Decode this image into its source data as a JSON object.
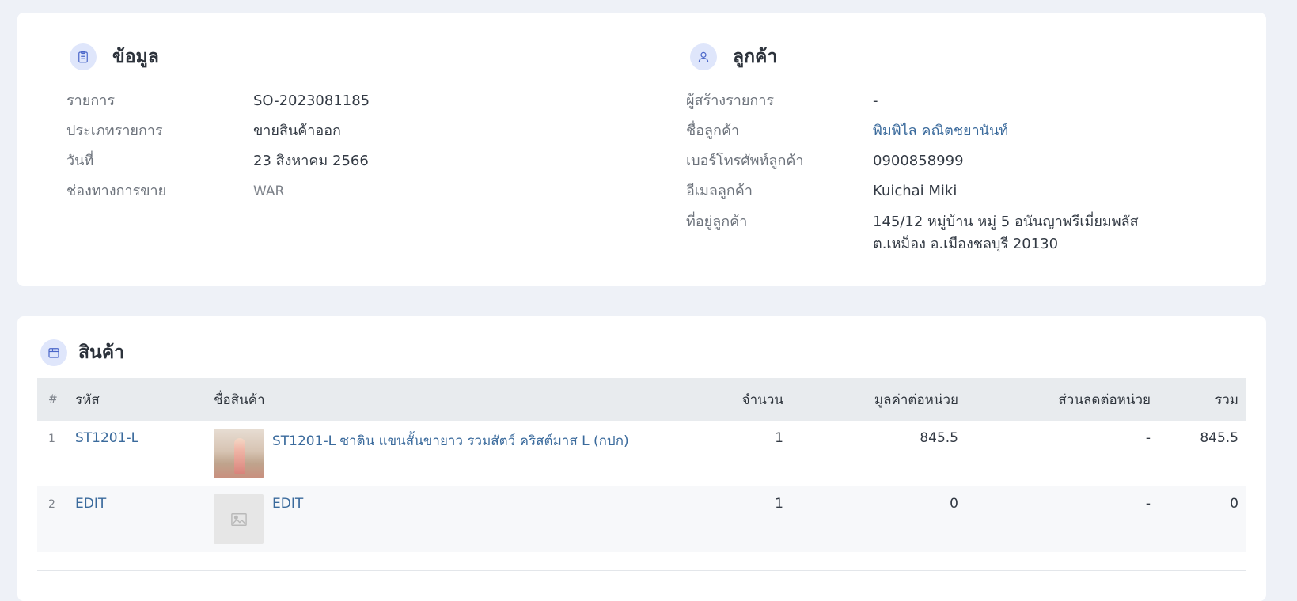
{
  "info": {
    "title": "ข้อมูล",
    "rows": [
      {
        "label": "รายการ",
        "value": "SO-2023081185"
      },
      {
        "label": "ประเภทรายการ",
        "value": "ขายสินค้าออก"
      },
      {
        "label": "วันที่",
        "value": "23 สิงหาคม 2566"
      },
      {
        "label": "ช่องทางการขาย",
        "value": "WAR"
      }
    ]
  },
  "customer": {
    "title": "ลูกค้า",
    "rows": [
      {
        "label": "ผู้สร้างรายการ",
        "value": "-"
      },
      {
        "label": "ชื่อลูกค้า",
        "value": "พิมพิไล คณิตชยานันท์"
      },
      {
        "label": "เบอร์โทรศัพท์ลูกค้า",
        "value": "0900858999"
      },
      {
        "label": "อีเมลลูกค้า",
        "value": "Kuichai Miki"
      },
      {
        "label": "ที่อยู่ลูกค้า",
        "value": "145/12 หมู่บ้าน หมู่ 5 อนันญาพรีเมี่ยมพลัส",
        "value2": "ต.เหม็อง อ.เมืองชลบุรี 20130"
      }
    ]
  },
  "products": {
    "title": "สินค้า",
    "columns": {
      "index": "#",
      "code": "รหัส",
      "name": "ชื่อสินค้า",
      "qty": "จำนวน",
      "unit_price": "มูลค่าต่อหน่วย",
      "unit_discount": "ส่วนลดต่อหน่วย",
      "total": "รวม"
    },
    "rows": [
      {
        "index": "1",
        "code": "ST1201-L",
        "name": "ST1201-L ซาติน แขนสั้นขายาว รวมสัตว์ คริสต์มาส L (กปก)",
        "qty": "1",
        "unit_price": "845.5",
        "unit_discount": "-",
        "total": "845.5",
        "thumb": "product-photo"
      },
      {
        "index": "2",
        "code": "EDIT",
        "name": "EDIT",
        "qty": "1",
        "unit_price": "0",
        "unit_discount": "-",
        "total": "0",
        "thumb": "image-placeholder-icon"
      }
    ]
  },
  "colors": {
    "page_bg": "#eef1f7",
    "card_bg": "#ffffff",
    "icon_circle": "#dfe6fb",
    "icon_stroke": "#4a66c9",
    "link": "#3a6a9c",
    "table_header_bg": "#e8ebee"
  }
}
